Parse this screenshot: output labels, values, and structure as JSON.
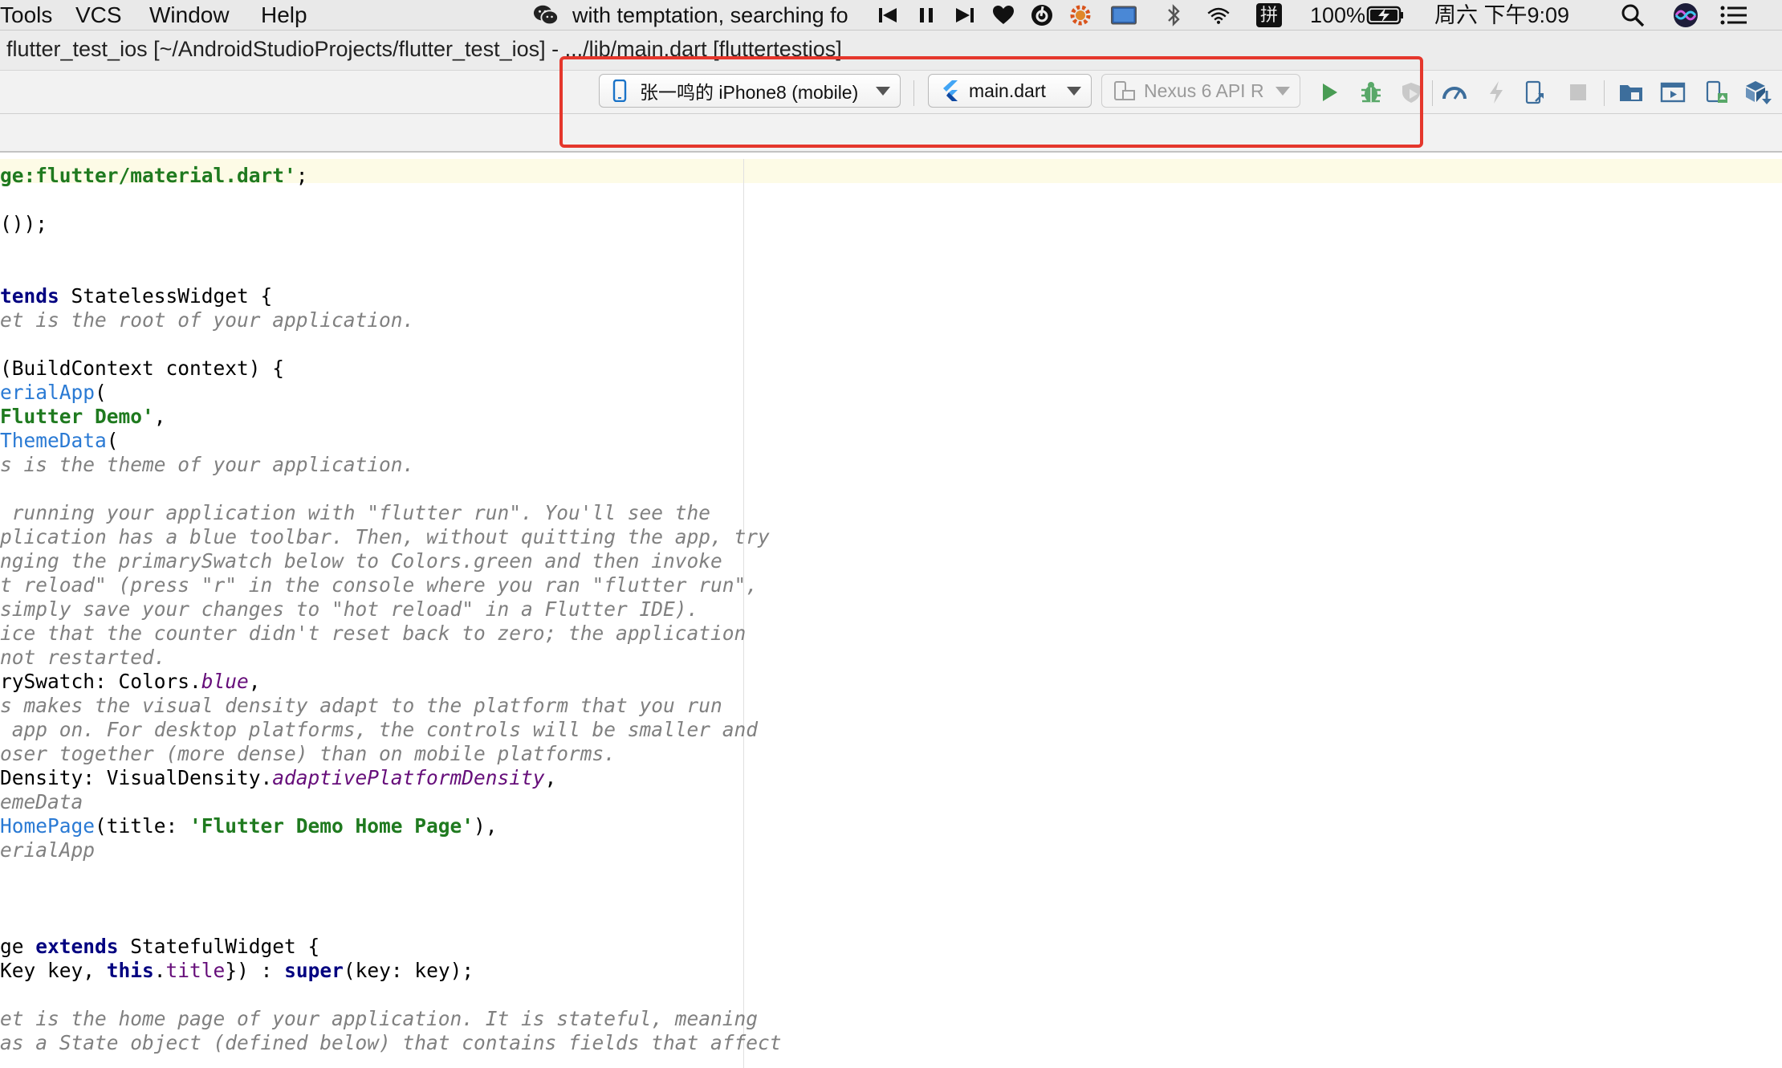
{
  "menu_bar": {
    "items": [
      "Tools",
      "VCS",
      "Window",
      "Help"
    ],
    "now_playing": "with temptation, searching fo",
    "battery": "100%",
    "clock": "周六 下午9:09",
    "input_method": "拼"
  },
  "window": {
    "title": "flutter_test_ios [~/AndroidStudioProjects/flutter_test_ios] - .../lib/main.dart [fluttertestios]"
  },
  "toolbar": {
    "device_selector": "张一鸣的 iPhone8 (mobile)",
    "run_config": "main.dart",
    "avd_selector": "Nexus 6 API R"
  },
  "colors": {
    "highlight": "#e5372c",
    "run": "#499c54",
    "debug": "#59a869",
    "keyword": "#000080",
    "string": "#1f7a1f",
    "comment": "#808080",
    "class_ref": "#2a7ad4"
  },
  "editor": {
    "lines": [
      [
        [
          "str",
          "ge:flutter/material.dart'"
        ],
        [
          "",
          ";"
        ]
      ],
      [],
      [
        [
          "",
          "());"
        ]
      ],
      [],
      [],
      [
        [
          "kw",
          "tends"
        ],
        [
          "",
          " StatelessWidget {"
        ]
      ],
      [
        [
          "cm",
          "et is the root of your application."
        ]
      ],
      [],
      [
        [
          "",
          "(BuildContext context) {"
        ]
      ],
      [
        [
          "cls",
          "erialApp"
        ],
        [
          "",
          "("
        ]
      ],
      [
        [
          "str",
          "Flutter Demo'"
        ],
        [
          "",
          ","
        ]
      ],
      [
        [
          "cls",
          "ThemeData"
        ],
        [
          "",
          "("
        ]
      ],
      [
        [
          "cm",
          "s is the theme of your application."
        ]
      ],
      [],
      [
        [
          "cm",
          " running your application with \"flutter run\". You'll see the"
        ]
      ],
      [
        [
          "cm",
          "plication has a blue toolbar. Then, without quitting the app, try"
        ]
      ],
      [
        [
          "cm",
          "nging the primarySwatch below to Colors.green and then invoke"
        ]
      ],
      [
        [
          "cm",
          "t reload\" (press \"r\" in the console where you ran \"flutter run\","
        ]
      ],
      [
        [
          "cm",
          "simply save your changes to \"hot reload\" in a Flutter IDE)."
        ]
      ],
      [
        [
          "cm",
          "ice that the counter didn't reset back to zero; the application"
        ]
      ],
      [
        [
          "cm",
          "not restarted."
        ]
      ],
      [
        [
          "",
          "rySwatch: Colors."
        ],
        [
          "fld",
          "blue"
        ],
        [
          "",
          ","
        ]
      ],
      [
        [
          "cm",
          "s makes the visual density adapt to the platform that you run"
        ]
      ],
      [
        [
          "cm",
          " app on. For desktop platforms, the controls will be smaller and"
        ]
      ],
      [
        [
          "cm",
          "oser together (more dense) than on mobile platforms."
        ]
      ],
      [
        [
          "",
          "Density: VisualDensity."
        ],
        [
          "fld",
          "adaptivePlatformDensity"
        ],
        [
          "",
          ","
        ]
      ],
      [
        [
          "cm",
          "emeData"
        ]
      ],
      [
        [
          "cls",
          "HomePage"
        ],
        [
          "",
          "(title: "
        ],
        [
          "str",
          "'Flutter Demo Home Page'"
        ],
        [
          "",
          "),"
        ]
      ],
      [
        [
          "cm",
          "erialApp"
        ]
      ],
      [],
      [],
      [],
      [
        [
          "",
          "ge "
        ],
        [
          "kw",
          "extends"
        ],
        [
          "",
          " StatefulWidget {"
        ]
      ],
      [
        [
          "",
          "Key key, "
        ],
        [
          "kw",
          "this"
        ],
        [
          "",
          "."
        ],
        [
          "fldn",
          "title"
        ],
        [
          "",
          "}) : "
        ],
        [
          "kw",
          "super"
        ],
        [
          "",
          "(key: key);"
        ]
      ],
      [],
      [
        [
          "cm",
          "et is the home page of your application. It is stateful, meaning"
        ]
      ],
      [
        [
          "cm",
          "as a State object (defined below) that contains fields that affect"
        ]
      ]
    ]
  }
}
